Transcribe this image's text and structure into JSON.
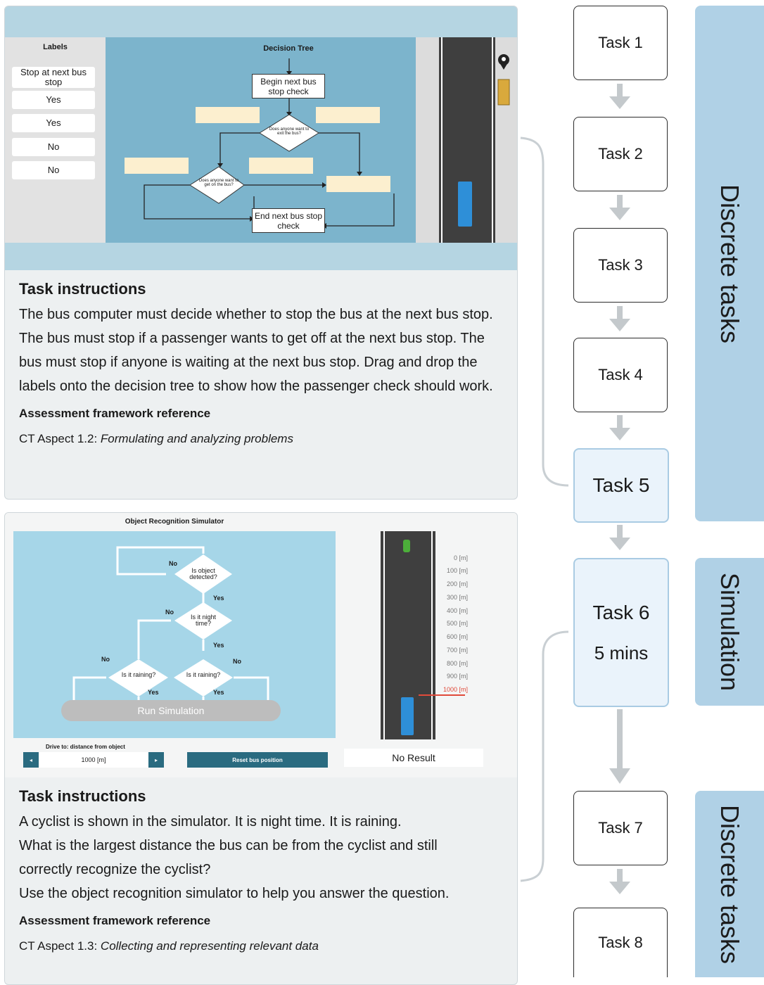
{
  "task1_card": {
    "labels_title": "Labels",
    "labels": [
      "Stop at next bus stop",
      "Yes",
      "Yes",
      "No",
      "No"
    ],
    "tree_title": "Decision Tree",
    "begin_box": "Begin next bus stop check",
    "end_box": "End next bus stop check",
    "q1": "Does anyone want to exit the bus?",
    "q2": "Does anyone want to get on the bus?",
    "instructions_title": "Task instructions",
    "instructions": "The bus computer must decide whether to stop the bus at the next bus stop. The bus must stop if a passenger wants to get off at the next bus stop. The bus must stop if anyone is waiting at the next bus stop. Drag and drop the labels onto the decision tree to show how the passenger check should work.",
    "ref_title": "Assessment framework reference",
    "ref_prefix": "CT Aspect 1.2: ",
    "ref_italic": "Formulating and analyzing problems"
  },
  "task6_card": {
    "sim_title": "Object Recognition Simulator",
    "q_detected": "Is object detected?",
    "q_night": "Is it night time?",
    "q_rain": "Is it raining?",
    "yes": "Yes",
    "no": "No",
    "run_button": "Run Simulation",
    "distance_label": "Drive to: distance from object",
    "distance_value": "1000 [m]",
    "reset_button": "Reset bus position",
    "result": "No Result",
    "ruler": [
      "0 [m]",
      "100 [m]",
      "200 [m]",
      "300 [m]",
      "400 [m]",
      "500 [m]",
      "600 [m]",
      "700 [m]",
      "800 [m]",
      "900 [m]",
      "1000 [m]"
    ],
    "instructions_title": "Task instructions",
    "instructions_lines": [
      "A cyclist is shown in the simulator. It is night time. It is raining.",
      "What is the largest distance the bus can be from the cyclist and still",
      "correctly recognize the cyclist?",
      "Use the object recognition simulator to help you answer the question."
    ],
    "ref_title": "Assessment framework reference",
    "ref_prefix": "CT Aspect 1.3: ",
    "ref_italic": "Collecting and representing relevant data"
  },
  "tasks": {
    "t1": "Task 1",
    "t2": "Task 2",
    "t3": "Task 3",
    "t4": "Task 4",
    "t5": "Task 5",
    "t6": "Task 6",
    "t6_time": "5 mins",
    "t7": "Task 7",
    "t8": "Task 8"
  },
  "bands": {
    "discrete_top": "Discrete tasks",
    "simulation": "Simulation",
    "discrete_bottom": "Discrete tasks"
  },
  "colors": {
    "band": "#b0d1e6",
    "tree_bg": "#7cb4cc",
    "sim_bg": "#a6d6e8",
    "drop_zone": "#fcefcf",
    "highlight_task": "#eaf3fb",
    "reset_button": "#2a6b80",
    "ruler_red": "#e04a3a"
  }
}
